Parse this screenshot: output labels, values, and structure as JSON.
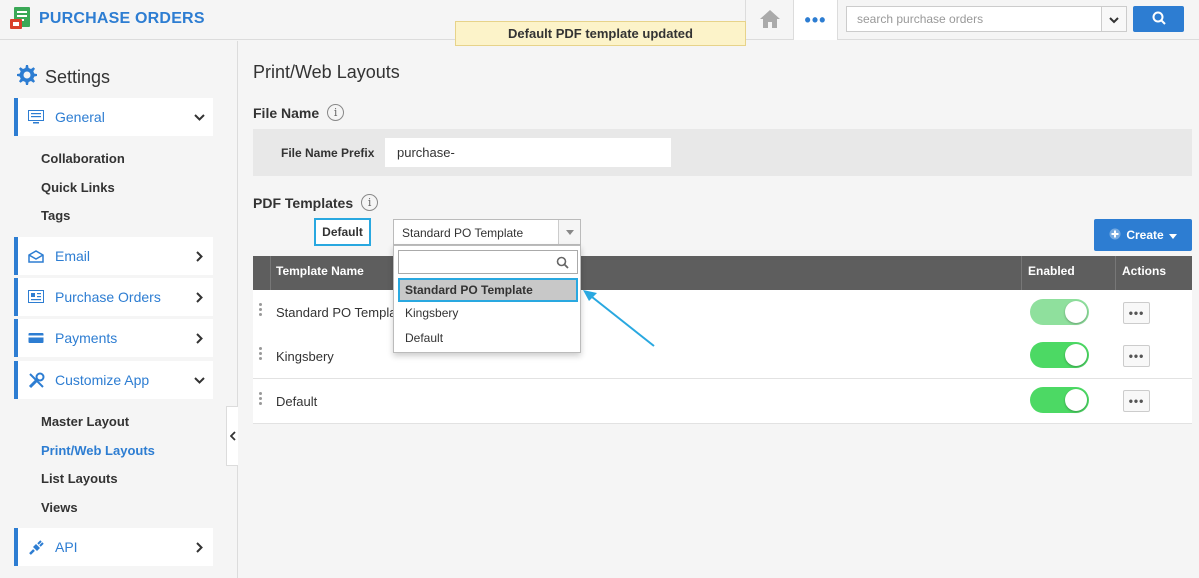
{
  "app": {
    "title": "PURCHASE ORDERS"
  },
  "toast": {
    "message": "Default PDF template updated"
  },
  "topbar": {
    "more_label": "•••",
    "search_placeholder": "search purchase orders"
  },
  "sidebar": {
    "title": "Settings",
    "items": [
      {
        "label": "General",
        "icon": "monitor-icon",
        "expanded": true
      },
      {
        "label": "Email",
        "icon": "envelope-icon",
        "expanded": false
      },
      {
        "label": "Purchase Orders",
        "icon": "document-icon",
        "expanded": false
      },
      {
        "label": "Payments",
        "icon": "card-icon",
        "expanded": false
      },
      {
        "label": "Customize App",
        "icon": "wrench-icon",
        "expanded": true
      },
      {
        "label": "API",
        "icon": "plug-icon",
        "expanded": false
      }
    ],
    "general_sub": [
      "Collaboration",
      "Quick Links",
      "Tags"
    ],
    "customize_sub": [
      "Master Layout",
      "Print/Web Layouts",
      "List Layouts",
      "Views"
    ],
    "active_sub": "Print/Web Layouts"
  },
  "main": {
    "page_title": "Print/Web Layouts",
    "file_name": {
      "section_title": "File Name",
      "prefix_label": "File Name Prefix",
      "prefix_value": "purchase-"
    },
    "pdf_templates": {
      "section_title": "PDF Templates",
      "default_label": "Default",
      "selected_template": "Standard PO Template",
      "create_label": "Create",
      "columns": [
        "Template Name",
        "Enabled",
        "Actions"
      ],
      "rows": [
        {
          "name": "Standard PO Template",
          "enabled": true
        },
        {
          "name": "Kingsbery",
          "enabled": true
        },
        {
          "name": "Default",
          "enabled": true
        }
      ],
      "action_label": "•••",
      "dropdown_options": [
        "Standard PO Template",
        "Kingsbery",
        "Default"
      ]
    }
  },
  "colors": {
    "accent": "#2d7dd2",
    "toggle_on": "#4cd964",
    "highlight_border": "#29a8e0",
    "toast_bg": "#fcf3c9"
  }
}
